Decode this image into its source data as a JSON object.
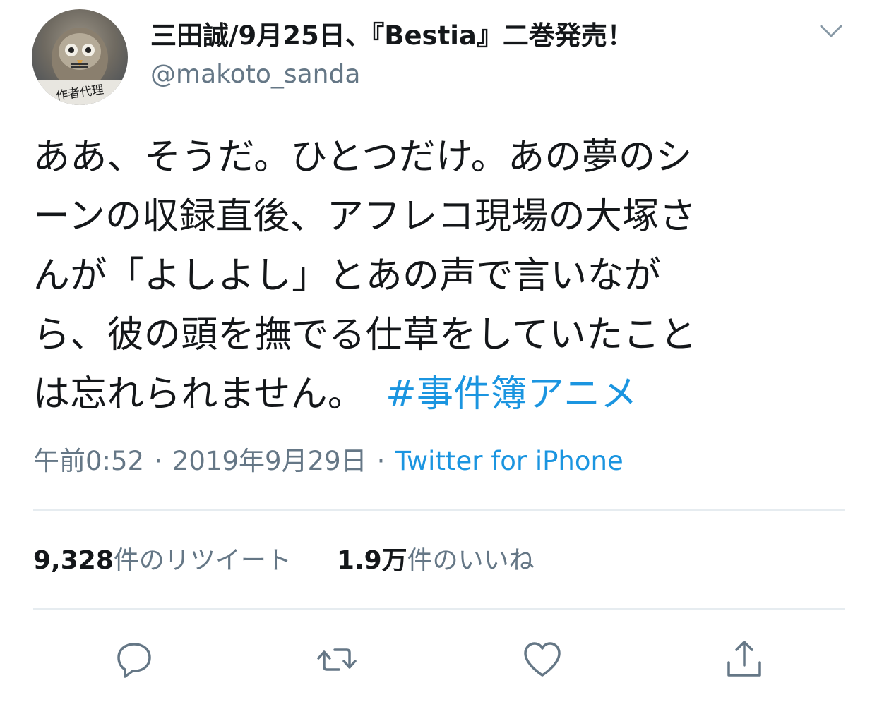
{
  "author": {
    "display_name": "三田誠/9月25日、『Bestia』二巻発売！",
    "handle": "@makoto_sanda",
    "avatar_label": "作者代理"
  },
  "tweet": {
    "lines": [
      "ああ、そうだ。ひとつだけ。あの夢のシ",
      "ーンの収録直後、アフレコ現場の大塚さ",
      "んが「よしよし」とあの声で言いなが",
      "ら、彼の頭を撫でる仕草をしていたこと",
      "は忘れられません。"
    ],
    "hashtag": "#事件簿アニメ"
  },
  "meta": {
    "time": "午前0:52",
    "separator": "·",
    "date": "2019年9月29日",
    "source": "Twitter for iPhone"
  },
  "stats": {
    "retweets_count": "9,328",
    "retweets_label": "件のリツイート",
    "likes_count": "1.9万",
    "likes_label": "件のいいね"
  },
  "colors": {
    "link": "#1b95e0",
    "secondary_text": "#657786",
    "divider": "#e6ecf0",
    "icon": "#657786"
  },
  "icons": {
    "menu": "chevron-down-icon",
    "reply": "reply-icon",
    "retweet": "retweet-icon",
    "like": "heart-icon",
    "share": "share-icon"
  }
}
